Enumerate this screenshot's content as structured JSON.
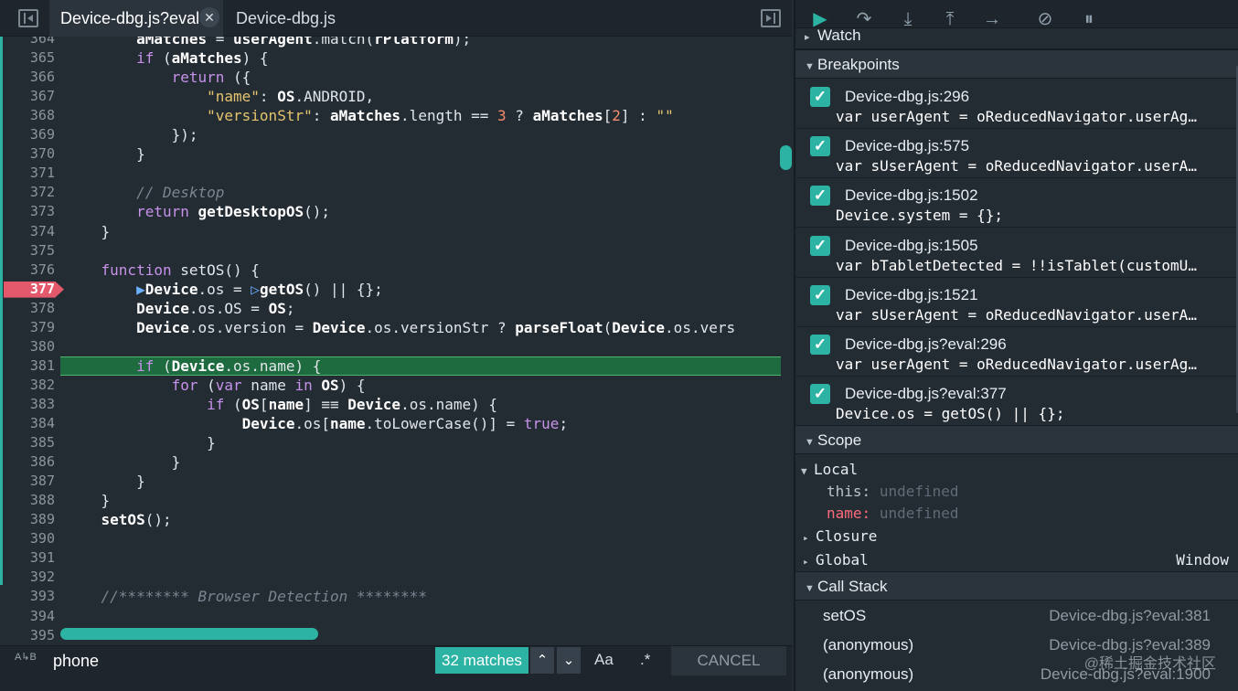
{
  "tabs": {
    "active_label": "Device-dbg.js?eval",
    "second_label": "Device-dbg.js",
    "close_glyph": "✕"
  },
  "code_lines": [
    {
      "n": "364",
      "html": "        <span class=\"id\">aMatches</span> = <span class=\"id\">userAgent</span>.match(<span class=\"id\">rPlatform</span>);"
    },
    {
      "n": "365",
      "html": "        <span class=\"kw\">if</span> (<span class=\"id\">aMatches</span>) {"
    },
    {
      "n": "366",
      "html": "            <span class=\"kw\">return</span> ({"
    },
    {
      "n": "367",
      "html": "                <span class=\"str\">\"name\"</span>: <span class=\"id\">OS</span>.ANDROID,"
    },
    {
      "n": "368",
      "html": "                <span class=\"str\">\"versionStr\"</span>: <span class=\"id\">aMatches</span>.length == <span class=\"num\">3</span> ? <span class=\"id\">aMatches</span>[<span class=\"num\">2</span>] : <span class=\"str\">\"\"</span>"
    },
    {
      "n": "369",
      "html": "            });"
    },
    {
      "n": "370",
      "html": "        }"
    },
    {
      "n": "371",
      "html": ""
    },
    {
      "n": "372",
      "html": "        <span class=\"cm\">// Desktop</span>"
    },
    {
      "n": "373",
      "html": "        <span class=\"kw\">return</span> <span class=\"id\">getDesktopOS</span>();"
    },
    {
      "n": "374",
      "html": "    }"
    },
    {
      "n": "375",
      "html": ""
    },
    {
      "n": "376",
      "html": "    <span class=\"kw\">function</span> setOS() {"
    },
    {
      "n": "377",
      "html": "        <span class=\"br\">▶</span><span class=\"id\">Device</span>.os = <span class=\"br\">▷</span><span class=\"id\">getOS</span>() || {};",
      "bp": true
    },
    {
      "n": "378",
      "html": "        <span class=\"id\">Device</span>.os.OS = <span class=\"id\">OS</span>;"
    },
    {
      "n": "379",
      "html": "        <span class=\"id\">Device</span>.os.version = <span class=\"id\">Device</span>.os.versionStr ? <span class=\"id\">parseFloat</span>(<span class=\"id\">Device</span>.os.vers"
    },
    {
      "n": "380",
      "html": ""
    },
    {
      "n": "381",
      "html": "        <span class=\"kw\">if</span> (<span class=\"id\">Device</span>.os.name) {",
      "paused": true
    },
    {
      "n": "382",
      "html": "            <span class=\"kw\">for</span> (<span class=\"kw\">var</span> name <span class=\"kw\">in</span> <span class=\"id\">OS</span>) {"
    },
    {
      "n": "383",
      "html": "                <span class=\"kw\">if</span> (<span class=\"id\">OS</span>[<span class=\"id\">name</span>] ≡≡ <span class=\"id\">Device</span>.os.name) {"
    },
    {
      "n": "384",
      "html": "                    <span class=\"id\">Device</span>.os[<span class=\"id\">name</span>.toLowerCase()] = <span class=\"kw\">true</span>;"
    },
    {
      "n": "385",
      "html": "                }"
    },
    {
      "n": "386",
      "html": "            }"
    },
    {
      "n": "387",
      "html": "        }"
    },
    {
      "n": "388",
      "html": "    }"
    },
    {
      "n": "389",
      "html": "    <span class=\"id\">setOS</span>();"
    },
    {
      "n": "390",
      "html": ""
    },
    {
      "n": "391",
      "html": ""
    },
    {
      "n": "392",
      "html": ""
    },
    {
      "n": "393",
      "html": "    <span class=\"cm\">//******** Browser Detection ********</span>"
    },
    {
      "n": "394",
      "html": ""
    },
    {
      "n": "395",
      "html": ""
    }
  ],
  "search": {
    "icon_glyph": "A↳B",
    "value": "phone",
    "match_count": "32 matches",
    "prev_glyph": "⌃",
    "next_glyph": "⌄",
    "case_label": "Aa",
    "regex_label": ".*",
    "cancel_label": "CANCEL"
  },
  "debugger_toolbar": {
    "resume_icon": "resume-icon",
    "step_over_icon": "step-over-icon",
    "step_in_icon": "step-in-icon",
    "step_out_icon": "step-out-icon",
    "continue_icon": "continue-icon",
    "deactivate_icon": "deactivate-breakpoints-icon",
    "pause_exceptions_icon": "pause-on-exceptions-icon"
  },
  "sections": {
    "watch": "Watch",
    "breakpoints": "Breakpoints",
    "scope": "Scope",
    "call_stack": "Call Stack"
  },
  "breakpoints": [
    {
      "loc": "Device-dbg.js:296",
      "src": "var userAgent = oReducedNavigator.userAg…"
    },
    {
      "loc": "Device-dbg.js:575",
      "src": "var sUserAgent = oReducedNavigator.userA…"
    },
    {
      "loc": "Device-dbg.js:1502",
      "src": "Device.system = {};"
    },
    {
      "loc": "Device-dbg.js:1505",
      "src": "var bTabletDetected = !!isTablet(customU…"
    },
    {
      "loc": "Device-dbg.js:1521",
      "src": "var sUserAgent = oReducedNavigator.userA…"
    },
    {
      "loc": "Device-dbg.js?eval:296",
      "src": "var userAgent = oReducedNavigator.userAg…"
    },
    {
      "loc": "Device-dbg.js?eval:377",
      "src": "Device.os = getOS() || {};"
    }
  ],
  "scope": {
    "local_label": "Local",
    "this_key": "this:",
    "this_val": "undefined",
    "name_key": "name:",
    "name_val": "undefined",
    "closure_label": "Closure",
    "global_label": "Global",
    "global_val": "Window"
  },
  "call_stack": [
    {
      "fn": "setOS",
      "loc": "Device-dbg.js?eval:381"
    },
    {
      "fn": "(anonymous)",
      "loc": "Device-dbg.js?eval:389"
    },
    {
      "fn": "(anonymous)",
      "loc": "Device-dbg.js?eval:1900"
    }
  ],
  "watermark": "@稀土掘金技术社区",
  "colors": {
    "accent": "#2cb3a4",
    "breakpoint": "#e3596b",
    "paused_line": "#1e6b3f",
    "background": "#232b33"
  }
}
